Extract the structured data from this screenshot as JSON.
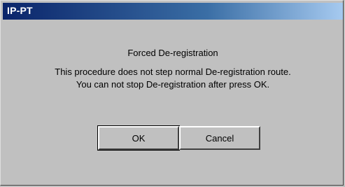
{
  "window": {
    "title": "IP-PT"
  },
  "dialog": {
    "heading": "Forced De-registration",
    "line1": "This procedure does not step normal De-registration route.",
    "line2": "You can not stop De-registration after press OK."
  },
  "buttons": {
    "ok_label": "OK",
    "cancel_label": "Cancel"
  },
  "colors": {
    "titlebar_start": "#0a246a",
    "titlebar_end": "#a6caf0",
    "dialog_background": "#c0c0c0"
  }
}
